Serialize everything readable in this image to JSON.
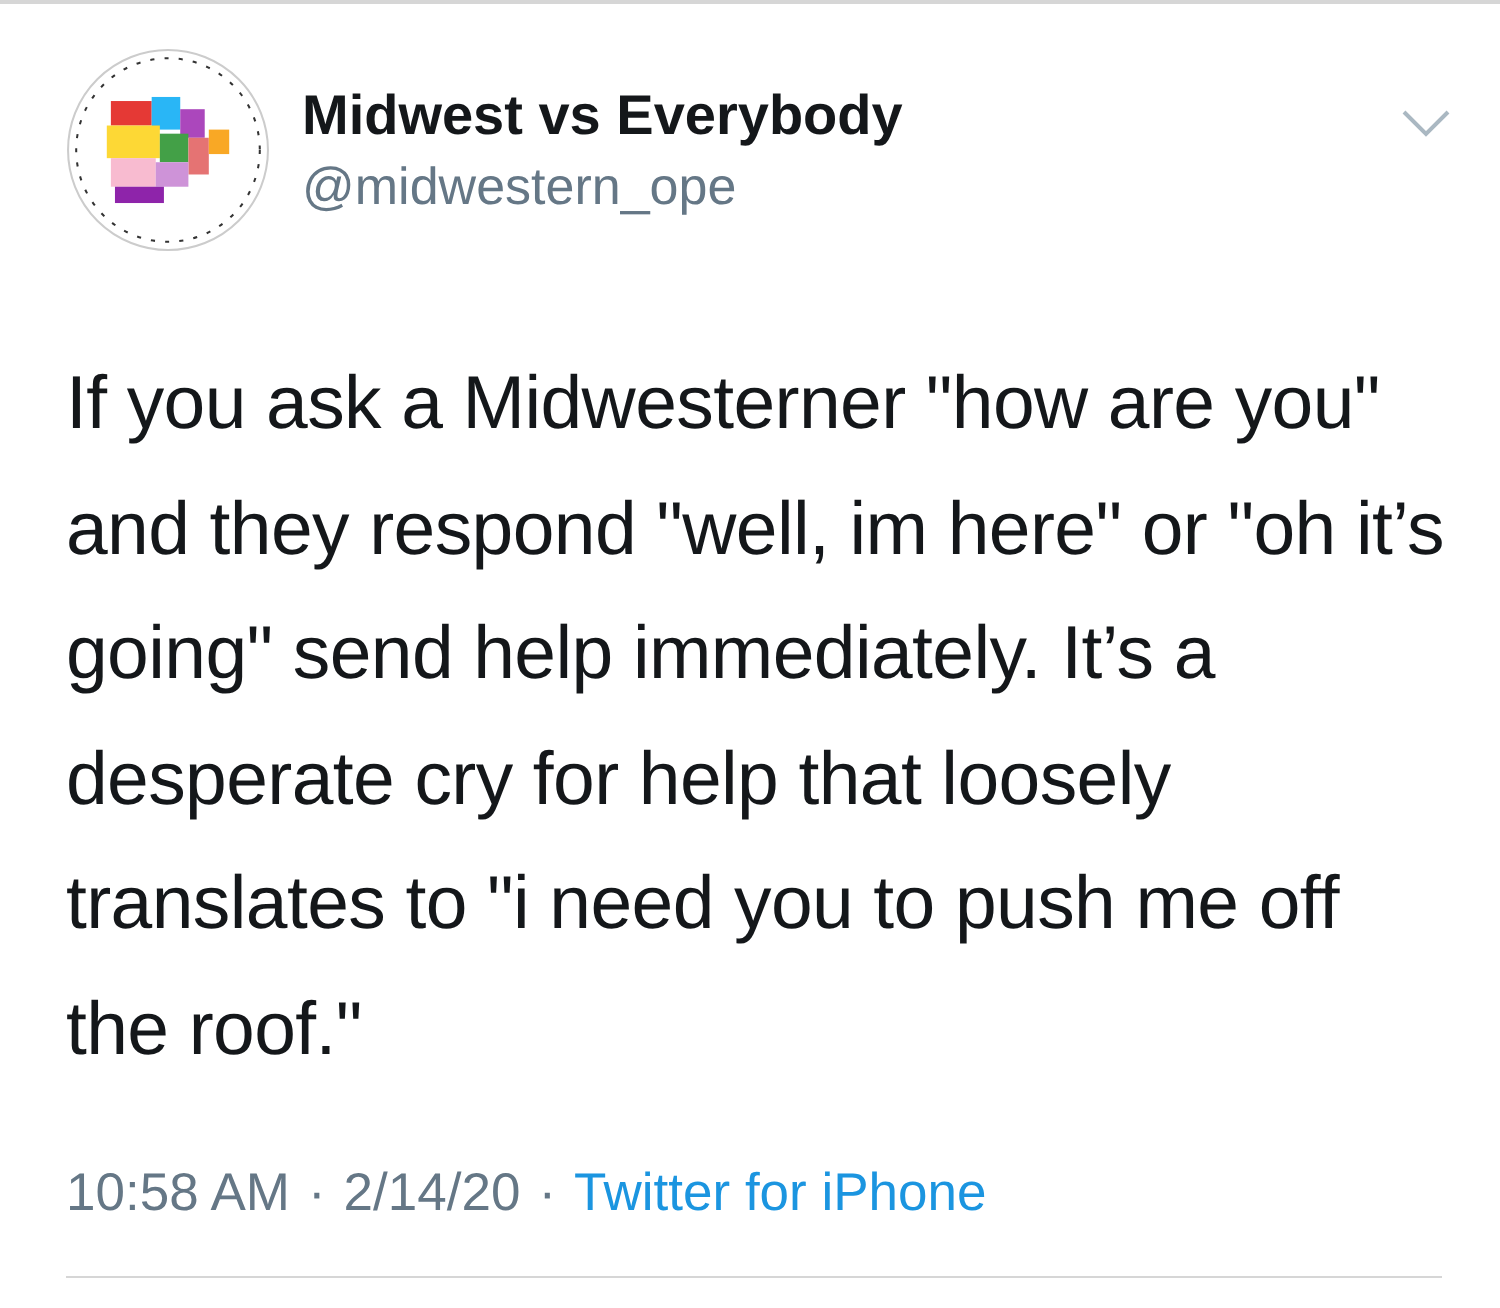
{
  "tweet": {
    "author": {
      "name": "Midwest vs Everybody",
      "handle": "@midwestern_ope"
    },
    "text": "If you ask a Midwesterner \"how are you\" and they respond \"well, im here\" or \"oh it’s going\" send help immediately. It’s a desperate cry for help that loosely translates to \"i need you to push me off the roof.\"",
    "time": "10:58 AM",
    "date": "2/14/20",
    "source": "Twitter for iPhone",
    "separator": "·"
  }
}
